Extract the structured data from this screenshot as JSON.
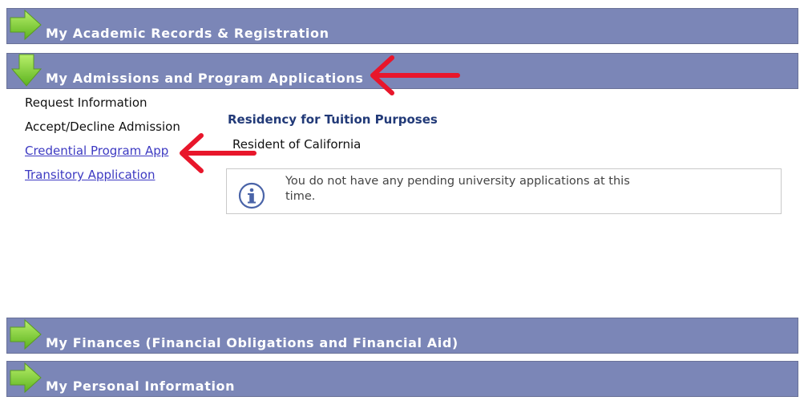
{
  "sections": [
    {
      "title": "My Academic Records & Registration",
      "expanded": false
    },
    {
      "title": "My Admissions and Program Applications",
      "expanded": true
    },
    {
      "title": "My Finances (Financial Obligations and Financial Aid)",
      "expanded": false
    },
    {
      "title": "My Personal Information",
      "expanded": false
    }
  ],
  "admissions": {
    "menu": [
      {
        "label": "Request Information",
        "link": false
      },
      {
        "label": "Accept/Decline Admission",
        "link": false
      },
      {
        "label": "Credential Program App",
        "link": true
      },
      {
        "label": "Transitory Application",
        "link": true
      }
    ],
    "residency_title": "Residency for Tuition Purposes",
    "residency_value": "Resident of California",
    "info_message": "You do not have any pending university applications at this time."
  },
  "icons": {
    "collapsed_arrow": "green-right-arrow-icon",
    "expanded_arrow": "green-down-arrow-icon",
    "info": "info-icon",
    "annotation": "red-arrow-annotation"
  },
  "colors": {
    "bar_bg": "#7b86b7",
    "arrow_green": "#7ecb3a",
    "link": "#3d3ac2",
    "heading": "#223a78",
    "annotation_red": "#e8162b"
  }
}
